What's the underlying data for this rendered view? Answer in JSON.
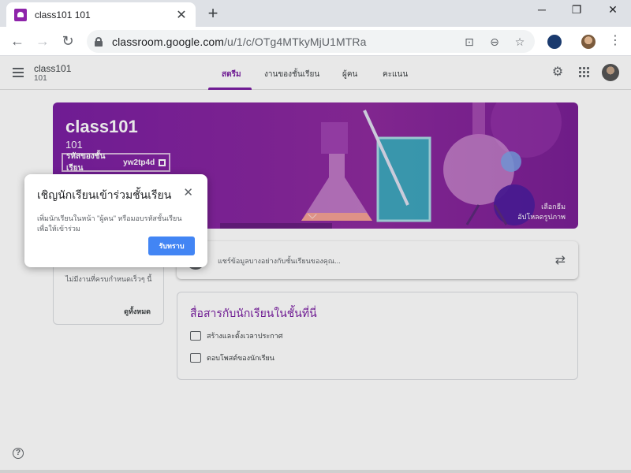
{
  "browser": {
    "tab_title": "class101 101",
    "tab_close": "✕",
    "new_tab": "+",
    "window_controls": [
      "─",
      "❐",
      "✕"
    ],
    "url_main": "classroom.google.com",
    "url_path": "/u/1/c/OTg4MTkyMjU1MTRa"
  },
  "classroom": {
    "class_name": "class101",
    "class_section": "101",
    "tabs": [
      "สตรีม",
      "งานของชั้นเรียน",
      "ผู้คน",
      "คะแนน"
    ],
    "active_tab": "สตรีม"
  },
  "banner": {
    "title": "class101",
    "subtitle": "101",
    "code_label": "รหัสของชั้นเรียน",
    "code_value": "yw2tp4d",
    "select_theme": "เลือกธีม",
    "upload_photo": "อัปโหลดรูปภาพ"
  },
  "upcoming": {
    "text": "ไม่มีงานที่ครบกำหนดเร็วๆ นี้",
    "view_all": "ดูทั้งหมด"
  },
  "share": {
    "placeholder": "แชร์ข้อมูลบางอย่างกับชั้นเรียนของคุณ..."
  },
  "communicate": {
    "title": "สื่อสารกับนักเรียนในชั้นที่นี่",
    "items": [
      "สร้างและตั้งเวลาประกาศ",
      "ตอบโพสต์ของนักเรียน"
    ]
  },
  "popup": {
    "title": "เชิญนักเรียนเข้าร่วมชั้นเรียน",
    "body": "เพิ่มนักเรียนในหน้า \"ผู้คน\" หรือมอบรหัสชั้นเรียนเพื่อให้เข้าร่วม",
    "button": "รับทราบ",
    "close": "✕"
  },
  "help": "?",
  "colors": {
    "brand": "#7b1fa2",
    "button_blue": "#4285f4"
  }
}
